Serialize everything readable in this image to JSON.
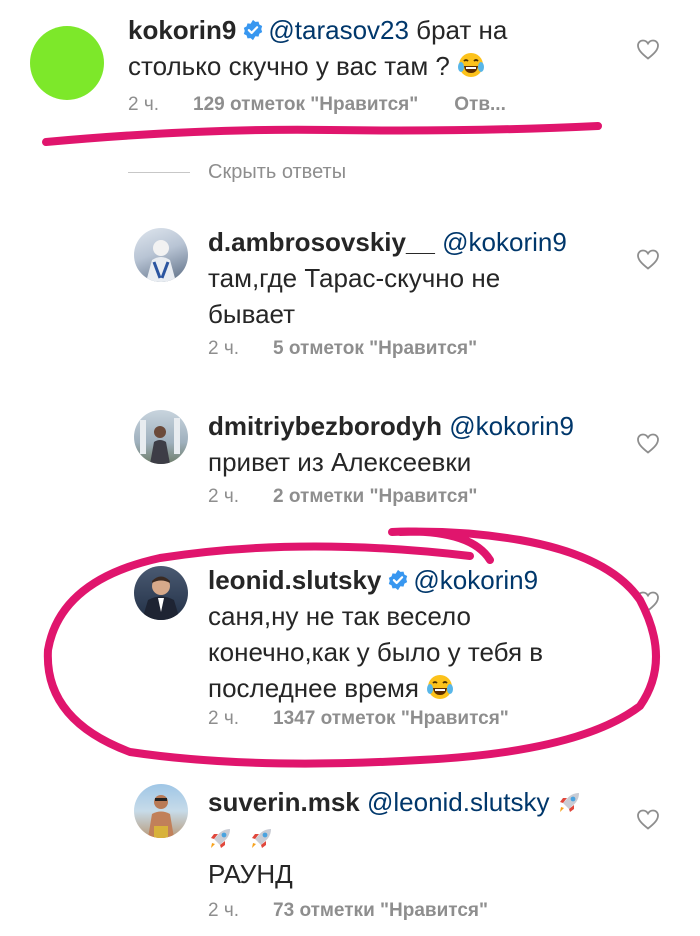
{
  "comments": [
    {
      "username": "kokorin9",
      "verified": true,
      "mention": "@tarasov23",
      "text_line1": " брат на",
      "text_line2": "столько скучно у вас там ?",
      "emoji": "laughing-tears",
      "time": "2 ч.",
      "likes": "129 отметок \"Нравится\"",
      "reply": "Отв..."
    }
  ],
  "hide_replies": "Скрыть ответы",
  "replies": [
    {
      "username": "d.ambrosovskiy__",
      "verified": false,
      "mention": "@kokorin9",
      "text_line1": "там,где Тарас-скучно не",
      "text_line2": "бывает",
      "time": "2 ч.",
      "likes": "5 отметок \"Нравится\""
    },
    {
      "username": "dmitriybezborodyh",
      "verified": false,
      "mention": "@kokorin9",
      "text_line1": "привет из Алексеевки",
      "time": "2 ч.",
      "likes": "2 отметки \"Нравится\""
    },
    {
      "username": "leonid.slutsky",
      "verified": true,
      "mention": "@kokorin9",
      "text_line1": "саня,ну не так весело",
      "text_line2": "конечно,как у было у тебя в",
      "text_line3": "последнее время",
      "emoji": "laughing-tears",
      "time": "2 ч.",
      "likes": "1347 отметок \"Нравится\""
    },
    {
      "username": "suverin.msk",
      "verified": false,
      "mention": "@leonid.slutsky",
      "emoji": "rocket",
      "text_line3": "РАУНД",
      "time": "2 ч.",
      "likes": "73 отметки \"Нравится\""
    }
  ],
  "colors": {
    "annotation": "#e0156d",
    "avatar_main": "#7de82a",
    "mention": "#00376b",
    "verified": "#3897f0",
    "muted": "#8e8e8e"
  },
  "icons": [
    "verified-badge-icon",
    "heart-icon",
    "laughing-tears-emoji",
    "rocket-emoji"
  ]
}
